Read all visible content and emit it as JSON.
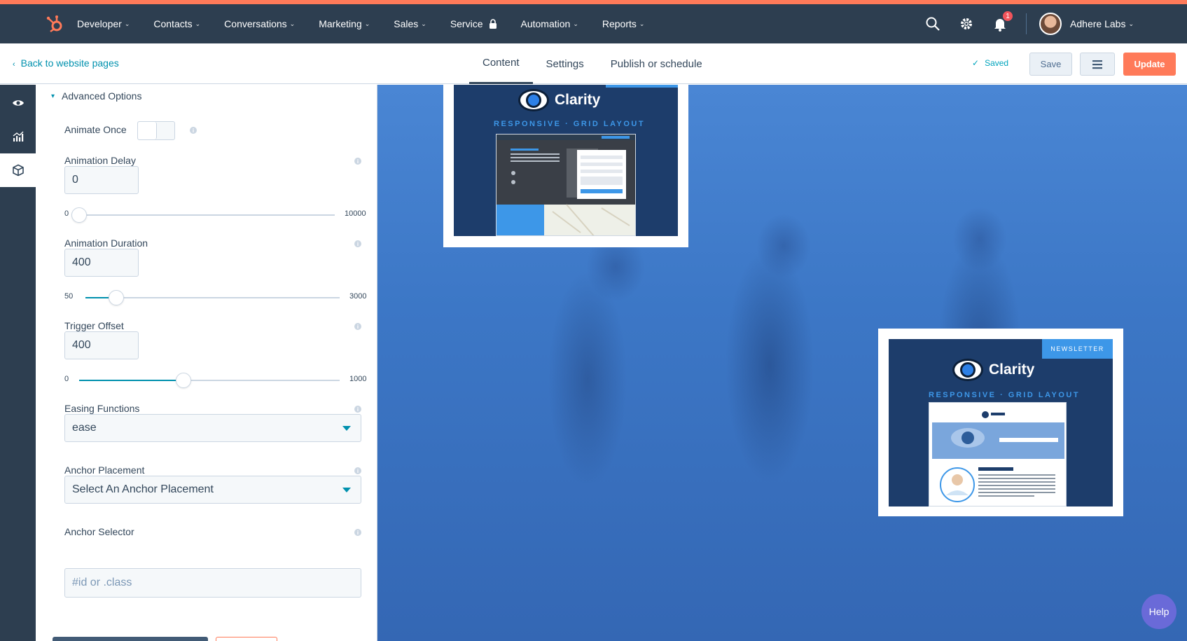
{
  "nav": {
    "items": [
      {
        "label": "Developer",
        "chevron": true
      },
      {
        "label": "Contacts",
        "chevron": true
      },
      {
        "label": "Conversations",
        "chevron": true
      },
      {
        "label": "Marketing",
        "chevron": true
      },
      {
        "label": "Sales",
        "chevron": true
      },
      {
        "label": "Service",
        "chevron": false,
        "lock": true
      },
      {
        "label": "Automation",
        "chevron": true
      },
      {
        "label": "Reports",
        "chevron": true
      }
    ],
    "notification_count": "1",
    "account_name": "Adhere Labs"
  },
  "editor": {
    "back_link": "Back to website pages",
    "tabs": [
      "Content",
      "Settings",
      "Publish or schedule"
    ],
    "active_tab": "Content",
    "saved_status": "Saved",
    "save_label": "Save",
    "update_label": "Update"
  },
  "panel": {
    "section_title": "Advanced Options",
    "animate_once": {
      "label": "Animate Once",
      "enabled": false
    },
    "animation_delay": {
      "label": "Animation Delay",
      "value": "0",
      "min": "0",
      "max": "10000",
      "fraction": 0.0
    },
    "animation_duration": {
      "label": "Animation Duration",
      "value": "400",
      "min": "50",
      "max": "3000",
      "fraction": 0.12
    },
    "trigger_offset": {
      "label": "Trigger Offset",
      "value": "400",
      "min": "0",
      "max": "1000",
      "fraction": 0.4
    },
    "easing": {
      "label": "Easing Functions",
      "value": "ease"
    },
    "anchor_placement": {
      "label": "Anchor Placement",
      "value": "Select An Anchor Placement"
    },
    "anchor_selector": {
      "label": "Anchor Selector",
      "placeholder": "#id or .class"
    }
  },
  "preview": {
    "card1": {
      "brand": "Clarity",
      "tagline": "RESPONSIVE · GRID LAYOUT"
    },
    "card2": {
      "brand": "Clarity",
      "tagline": "RESPONSIVE · GRID LAYOUT",
      "ribbon": "NEWSLETTER"
    }
  },
  "help_label": "Help",
  "colors": {
    "nav_bg": "#2d3e50",
    "accent": "#ff7a59",
    "link": "#0091ae",
    "preview_blue": "#3c77c6"
  }
}
